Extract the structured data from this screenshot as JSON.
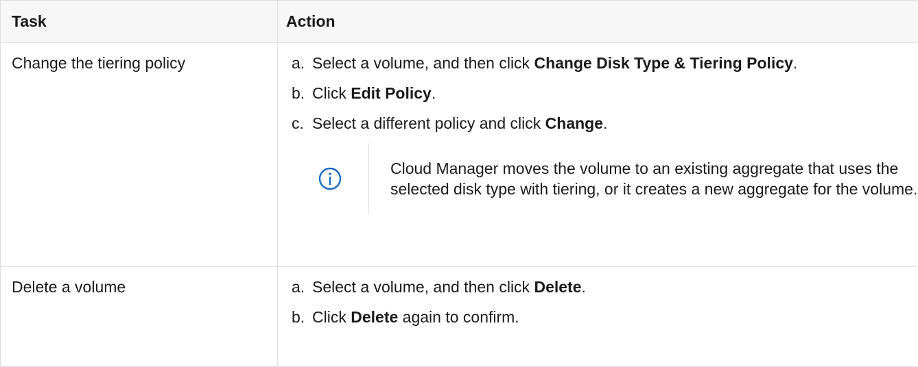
{
  "table": {
    "headers": [
      "Task",
      "Action"
    ],
    "rows": [
      {
        "task": "Change the tiering policy",
        "steps": [
          {
            "marker": "a.",
            "text": "Select a volume, and then click ",
            "bold": "Change Disk Type & Tiering Policy",
            "after": "."
          },
          {
            "marker": "b.",
            "text": "Click ",
            "bold": "Edit Policy",
            "after": "."
          },
          {
            "marker": "c.",
            "text": "Select a different policy and click ",
            "bold": "Change",
            "after": "."
          }
        ],
        "note": {
          "icon": "info-icon",
          "text": "Cloud Manager moves the volume to an existing aggregate that uses the selected disk type with tiering, or it creates a new aggregate for the volume."
        }
      },
      {
        "task": "Delete a volume",
        "steps": [
          {
            "marker": "a.",
            "text": "Select a volume, and then click ",
            "bold": "Delete",
            "after": "."
          },
          {
            "marker": "b.",
            "text": "Click ",
            "bold": "Delete",
            "after": " again to confirm."
          }
        ]
      }
    ]
  },
  "colors": {
    "border": "#dedede",
    "header_bg": "#f7f7f7",
    "icon": "#1769c2",
    "text": "#1a1a1a"
  }
}
